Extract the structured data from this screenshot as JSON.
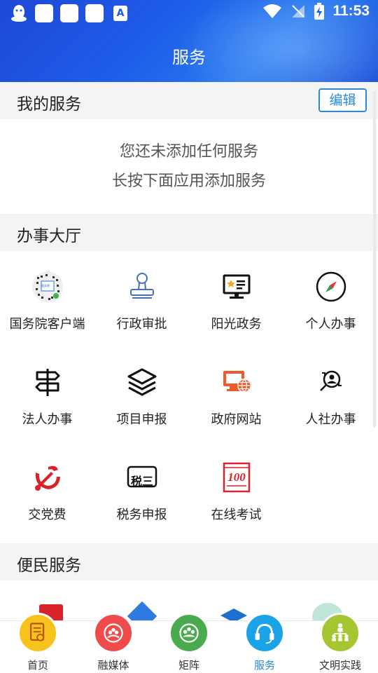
{
  "status_bar": {
    "time": "11:53"
  },
  "header": {
    "title": "服务"
  },
  "my_services": {
    "title": "我的服务",
    "edit_label": "编辑",
    "empty_line1": "您还未添加任何服务",
    "empty_line2": "长按下面应用添加服务"
  },
  "hall": {
    "title": "办事大厅",
    "items": [
      {
        "label": "国务院客户端",
        "icon": "qr-code-icon"
      },
      {
        "label": "行政审批",
        "icon": "stamp-icon"
      },
      {
        "label": "阳光政务",
        "icon": "monitor-star-icon"
      },
      {
        "label": "个人办事",
        "icon": "compass-icon"
      },
      {
        "label": "法人办事",
        "icon": "signpost-icon"
      },
      {
        "label": "项目申报",
        "icon": "layers-icon"
      },
      {
        "label": "政府网站",
        "icon": "web-monitor-icon"
      },
      {
        "label": "人社办事",
        "icon": "person-search-icon"
      },
      {
        "label": "交党费",
        "icon": "party-emblem-icon"
      },
      {
        "label": "税务申报",
        "icon": "tax-icon"
      },
      {
        "label": "在线考试",
        "icon": "exam-score-icon"
      }
    ]
  },
  "convenience": {
    "title": "便民服务"
  },
  "tax_icon_text": "税三",
  "exam_icon_text": "100",
  "qr_icon_text": "国务院",
  "bottom_nav": [
    {
      "label": "首页",
      "icon": "home-icon",
      "color": "#f7c21b"
    },
    {
      "label": "融媒体",
      "icon": "media-icon",
      "color": "#ef4b4b"
    },
    {
      "label": "矩阵",
      "icon": "matrix-icon",
      "color": "#4aaa4e"
    },
    {
      "label": "服务",
      "icon": "headset-icon",
      "color": "#1ba3e8",
      "active": true
    },
    {
      "label": "文明实践",
      "icon": "practice-icon",
      "color": "#a5c630"
    }
  ]
}
